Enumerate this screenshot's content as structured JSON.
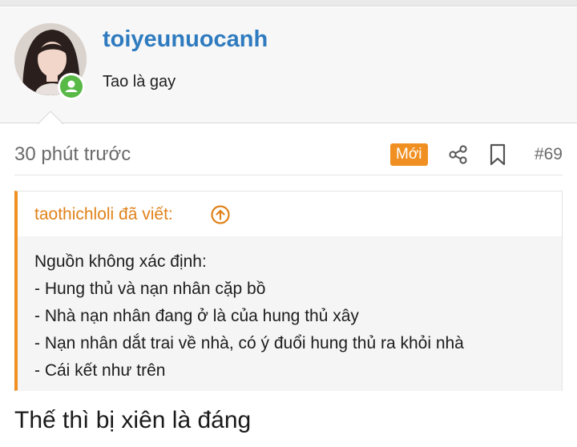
{
  "user": {
    "username": "toiyeunuocanh",
    "title": "Tao là gay",
    "online_color": "#58b947"
  },
  "post": {
    "time": "30 phút trước",
    "new_badge": "Mới",
    "number": "#69",
    "share_icon": "share-icon",
    "bookmark_icon": "bookmark-icon"
  },
  "quote": {
    "author_line": "taothichloli đã viết:",
    "jump_icon": "arrow-up-circle-icon",
    "lines": [
      "Nguồn không xác định:",
      "- Hung thủ và nạn nhân cặp bồ",
      "- Nhà nạn nhân đang ở là của hung thủ xây",
      "- Nạn nhân dắt trai về nhà, có ý đuổi hung thủ ra khỏi nhà",
      "- Cái kết như trên"
    ]
  },
  "reply": {
    "text": "Thế thì bị xiên là đáng"
  },
  "colors": {
    "accent_orange": "#f09022",
    "username_blue": "#2f7bbf"
  }
}
